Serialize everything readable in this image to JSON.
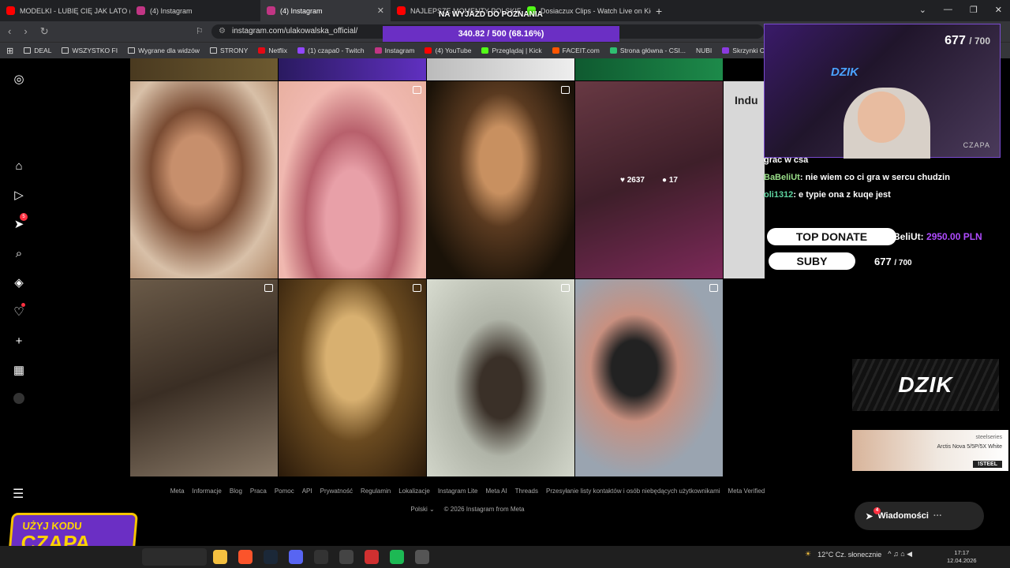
{
  "tabs": [
    {
      "label": "MODELKI - LUBIĘ CIĘ JAK LATO (pro",
      "color": "#ff0000"
    },
    {
      "label": "(4) Instagram",
      "color": "#c13584"
    },
    {
      "label": "(4) Instagram",
      "color": "#c13584",
      "active": true
    },
    {
      "label": "NAJLEPSZE MOMENTY POLSKIEGO",
      "color": "#ff0000"
    },
    {
      "label": "Dosiaczux Clips - Watch Live on Kick",
      "color": "#53fc18"
    }
  ],
  "address": {
    "url": "instagram.com/ulakowalska_official/"
  },
  "overlay": {
    "title": "NA WYJAZD DO POZNANIA",
    "progress": "340.82 / 500 (68.16%)",
    "progress_fraction": 0.6816
  },
  "bookmarks": [
    "DEAL",
    "WSZYSTKO FI",
    "Wygrane dla widzów",
    "STRONY",
    "Netflix",
    "(1) czapa0 - Twitch",
    "Instagram",
    "(4) YouTube",
    "Przeglądaj | Kick",
    "FACEIT.com",
    "Strona główna - CSI...",
    "NUBI",
    "Skrzynki CS:GO/CS2"
  ],
  "sidebar": {
    "notifications_badge": "5"
  },
  "grid": {
    "hover_likes": "2637",
    "hover_comments": "17",
    "side_text": "Indu"
  },
  "footer": {
    "links": [
      "Meta",
      "Informacje",
      "Blog",
      "Praca",
      "Pomoc",
      "API",
      "Prywatność",
      "Regulamin",
      "Lokalizacje",
      "Instagram Lite",
      "Meta AI",
      "Threads",
      "Przesyłanie listy kontaktów i osób niebędących użytkownikami",
      "Meta Verified"
    ],
    "language": "Polski",
    "copyright": "© 2026 Instagram from Meta"
  },
  "stream": {
    "counter_value": "677",
    "counter_max": "/ 700",
    "cam_logo": "DZIK",
    "cam_name": "CZAPA",
    "chat": [
      {
        "user": "",
        "text": "grac w csa"
      },
      {
        "user": "BaBeliUt",
        "text": ": nie wiem co ci gra w sercu chudzin"
      },
      {
        "user": "oli1312",
        "text": ": e typie ona z kuqe jest"
      }
    ],
    "top_donate_label": "TOP DONATE",
    "top_donate_user": "BeliUt:",
    "top_donate_value": "2950.00 PLN",
    "subs_label": "SUBY",
    "subs_value": "677",
    "subs_max": "/ 700",
    "sponsor": "DZIK",
    "ad": {
      "brand": "steelseries",
      "product": "Arctis Nova 5/5P/5X White",
      "code": "!STEEL"
    },
    "promo_line1": "UŻYJ KODU",
    "promo_line2": "CZAPA"
  },
  "messages": {
    "label": "Wiadomości",
    "badge": "4"
  },
  "taskbar": {
    "weather": "12°C  Cz. słonecznie",
    "time": "17:17",
    "date": "12.04.2026"
  }
}
